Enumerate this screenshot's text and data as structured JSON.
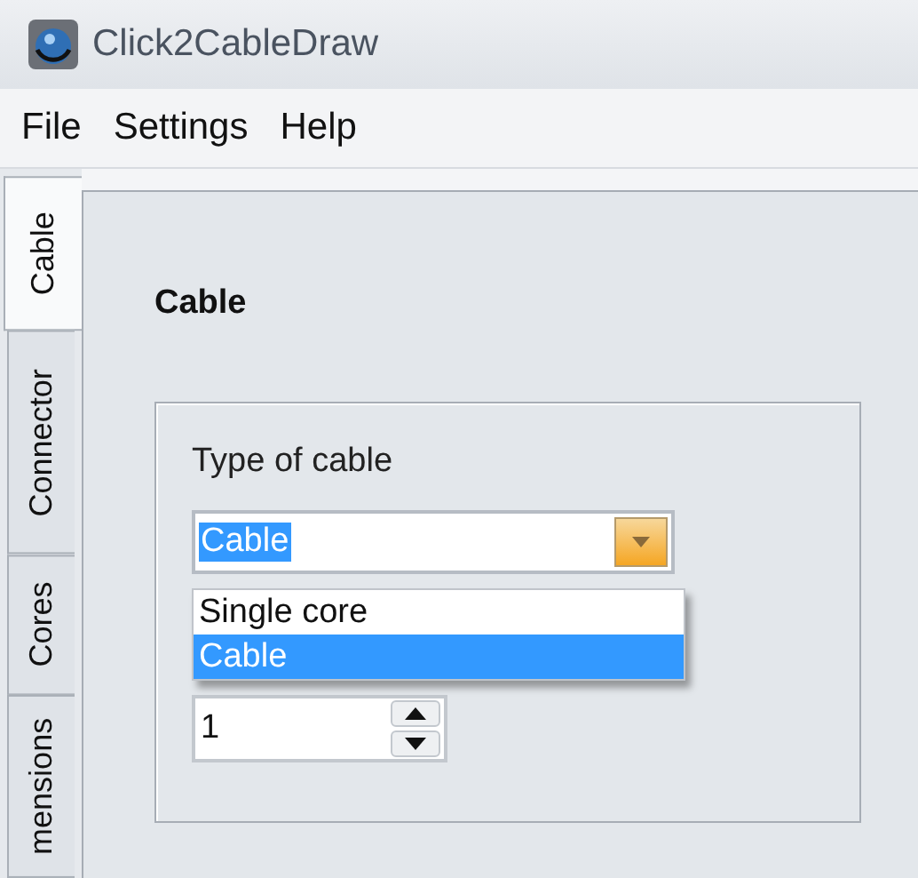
{
  "window": {
    "title": "Click2CableDraw"
  },
  "menu": [
    "File",
    "Settings",
    "Help"
  ],
  "tabs": [
    {
      "label": "Cable",
      "selected": true
    },
    {
      "label": "Connector",
      "selected": false
    },
    {
      "label": "Cores",
      "selected": false
    },
    {
      "label": "mensions",
      "selected": false
    }
  ],
  "panel": {
    "heading": "Cable",
    "group": {
      "label": "Type of cable",
      "combo": {
        "value": "Cable",
        "text_selected": true,
        "open": true,
        "options": [
          {
            "label": "Single core",
            "selected": false
          },
          {
            "label": "Cable",
            "selected": true
          }
        ]
      },
      "spin": {
        "value": "1"
      }
    }
  }
}
